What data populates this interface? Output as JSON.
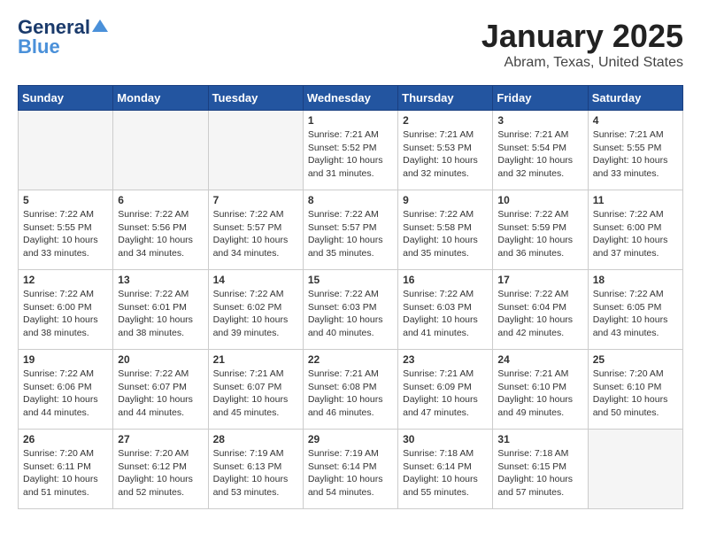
{
  "header": {
    "logo_line1": "General",
    "logo_line2": "Blue",
    "title": "January 2025",
    "subtitle": "Abram, Texas, United States"
  },
  "days_of_week": [
    "Sunday",
    "Monday",
    "Tuesday",
    "Wednesday",
    "Thursday",
    "Friday",
    "Saturday"
  ],
  "weeks": [
    [
      {
        "day": "",
        "info": ""
      },
      {
        "day": "",
        "info": ""
      },
      {
        "day": "",
        "info": ""
      },
      {
        "day": "1",
        "info": "Sunrise: 7:21 AM\nSunset: 5:52 PM\nDaylight: 10 hours and 31 minutes."
      },
      {
        "day": "2",
        "info": "Sunrise: 7:21 AM\nSunset: 5:53 PM\nDaylight: 10 hours and 32 minutes."
      },
      {
        "day": "3",
        "info": "Sunrise: 7:21 AM\nSunset: 5:54 PM\nDaylight: 10 hours and 32 minutes."
      },
      {
        "day": "4",
        "info": "Sunrise: 7:21 AM\nSunset: 5:55 PM\nDaylight: 10 hours and 33 minutes."
      }
    ],
    [
      {
        "day": "5",
        "info": "Sunrise: 7:22 AM\nSunset: 5:55 PM\nDaylight: 10 hours and 33 minutes."
      },
      {
        "day": "6",
        "info": "Sunrise: 7:22 AM\nSunset: 5:56 PM\nDaylight: 10 hours and 34 minutes."
      },
      {
        "day": "7",
        "info": "Sunrise: 7:22 AM\nSunset: 5:57 PM\nDaylight: 10 hours and 34 minutes."
      },
      {
        "day": "8",
        "info": "Sunrise: 7:22 AM\nSunset: 5:57 PM\nDaylight: 10 hours and 35 minutes."
      },
      {
        "day": "9",
        "info": "Sunrise: 7:22 AM\nSunset: 5:58 PM\nDaylight: 10 hours and 35 minutes."
      },
      {
        "day": "10",
        "info": "Sunrise: 7:22 AM\nSunset: 5:59 PM\nDaylight: 10 hours and 36 minutes."
      },
      {
        "day": "11",
        "info": "Sunrise: 7:22 AM\nSunset: 6:00 PM\nDaylight: 10 hours and 37 minutes."
      }
    ],
    [
      {
        "day": "12",
        "info": "Sunrise: 7:22 AM\nSunset: 6:00 PM\nDaylight: 10 hours and 38 minutes."
      },
      {
        "day": "13",
        "info": "Sunrise: 7:22 AM\nSunset: 6:01 PM\nDaylight: 10 hours and 38 minutes."
      },
      {
        "day": "14",
        "info": "Sunrise: 7:22 AM\nSunset: 6:02 PM\nDaylight: 10 hours and 39 minutes."
      },
      {
        "day": "15",
        "info": "Sunrise: 7:22 AM\nSunset: 6:03 PM\nDaylight: 10 hours and 40 minutes."
      },
      {
        "day": "16",
        "info": "Sunrise: 7:22 AM\nSunset: 6:03 PM\nDaylight: 10 hours and 41 minutes."
      },
      {
        "day": "17",
        "info": "Sunrise: 7:22 AM\nSunset: 6:04 PM\nDaylight: 10 hours and 42 minutes."
      },
      {
        "day": "18",
        "info": "Sunrise: 7:22 AM\nSunset: 6:05 PM\nDaylight: 10 hours and 43 minutes."
      }
    ],
    [
      {
        "day": "19",
        "info": "Sunrise: 7:22 AM\nSunset: 6:06 PM\nDaylight: 10 hours and 44 minutes."
      },
      {
        "day": "20",
        "info": "Sunrise: 7:22 AM\nSunset: 6:07 PM\nDaylight: 10 hours and 44 minutes."
      },
      {
        "day": "21",
        "info": "Sunrise: 7:21 AM\nSunset: 6:07 PM\nDaylight: 10 hours and 45 minutes."
      },
      {
        "day": "22",
        "info": "Sunrise: 7:21 AM\nSunset: 6:08 PM\nDaylight: 10 hours and 46 minutes."
      },
      {
        "day": "23",
        "info": "Sunrise: 7:21 AM\nSunset: 6:09 PM\nDaylight: 10 hours and 47 minutes."
      },
      {
        "day": "24",
        "info": "Sunrise: 7:21 AM\nSunset: 6:10 PM\nDaylight: 10 hours and 49 minutes."
      },
      {
        "day": "25",
        "info": "Sunrise: 7:20 AM\nSunset: 6:10 PM\nDaylight: 10 hours and 50 minutes."
      }
    ],
    [
      {
        "day": "26",
        "info": "Sunrise: 7:20 AM\nSunset: 6:11 PM\nDaylight: 10 hours and 51 minutes."
      },
      {
        "day": "27",
        "info": "Sunrise: 7:20 AM\nSunset: 6:12 PM\nDaylight: 10 hours and 52 minutes."
      },
      {
        "day": "28",
        "info": "Sunrise: 7:19 AM\nSunset: 6:13 PM\nDaylight: 10 hours and 53 minutes."
      },
      {
        "day": "29",
        "info": "Sunrise: 7:19 AM\nSunset: 6:14 PM\nDaylight: 10 hours and 54 minutes."
      },
      {
        "day": "30",
        "info": "Sunrise: 7:18 AM\nSunset: 6:14 PM\nDaylight: 10 hours and 55 minutes."
      },
      {
        "day": "31",
        "info": "Sunrise: 7:18 AM\nSunset: 6:15 PM\nDaylight: 10 hours and 57 minutes."
      },
      {
        "day": "",
        "info": ""
      }
    ]
  ]
}
